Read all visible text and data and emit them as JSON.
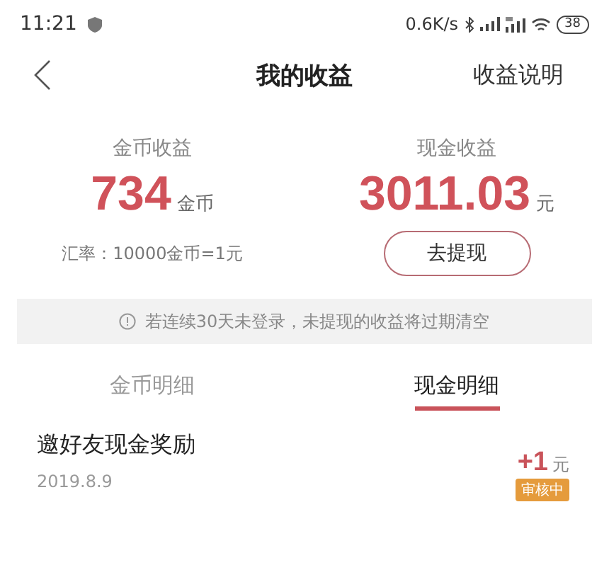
{
  "status_bar": {
    "time": "11:21",
    "speed": "0.6K/s",
    "battery": "38"
  },
  "header": {
    "title": "我的收益",
    "action": "收益说明"
  },
  "summary": [
    {
      "label": "金币收益",
      "amount": "734",
      "unit": "金币",
      "kind": "note",
      "note": "汇率：10000金币=1元"
    },
    {
      "label": "现金收益",
      "amount": "3011.03",
      "unit": "元",
      "kind": "button",
      "button": "去提现"
    }
  ],
  "notice": "若连续30天未登录，未提现的收益将过期清空",
  "tabs": [
    {
      "label": "金币明细",
      "selected": false
    },
    {
      "label": "现金明细",
      "selected": true
    }
  ],
  "records": [
    {
      "title": "邀好友现金奖励",
      "date": "2019.8.9",
      "amount": "+1",
      "unit": "元",
      "status": "审核中"
    }
  ]
}
